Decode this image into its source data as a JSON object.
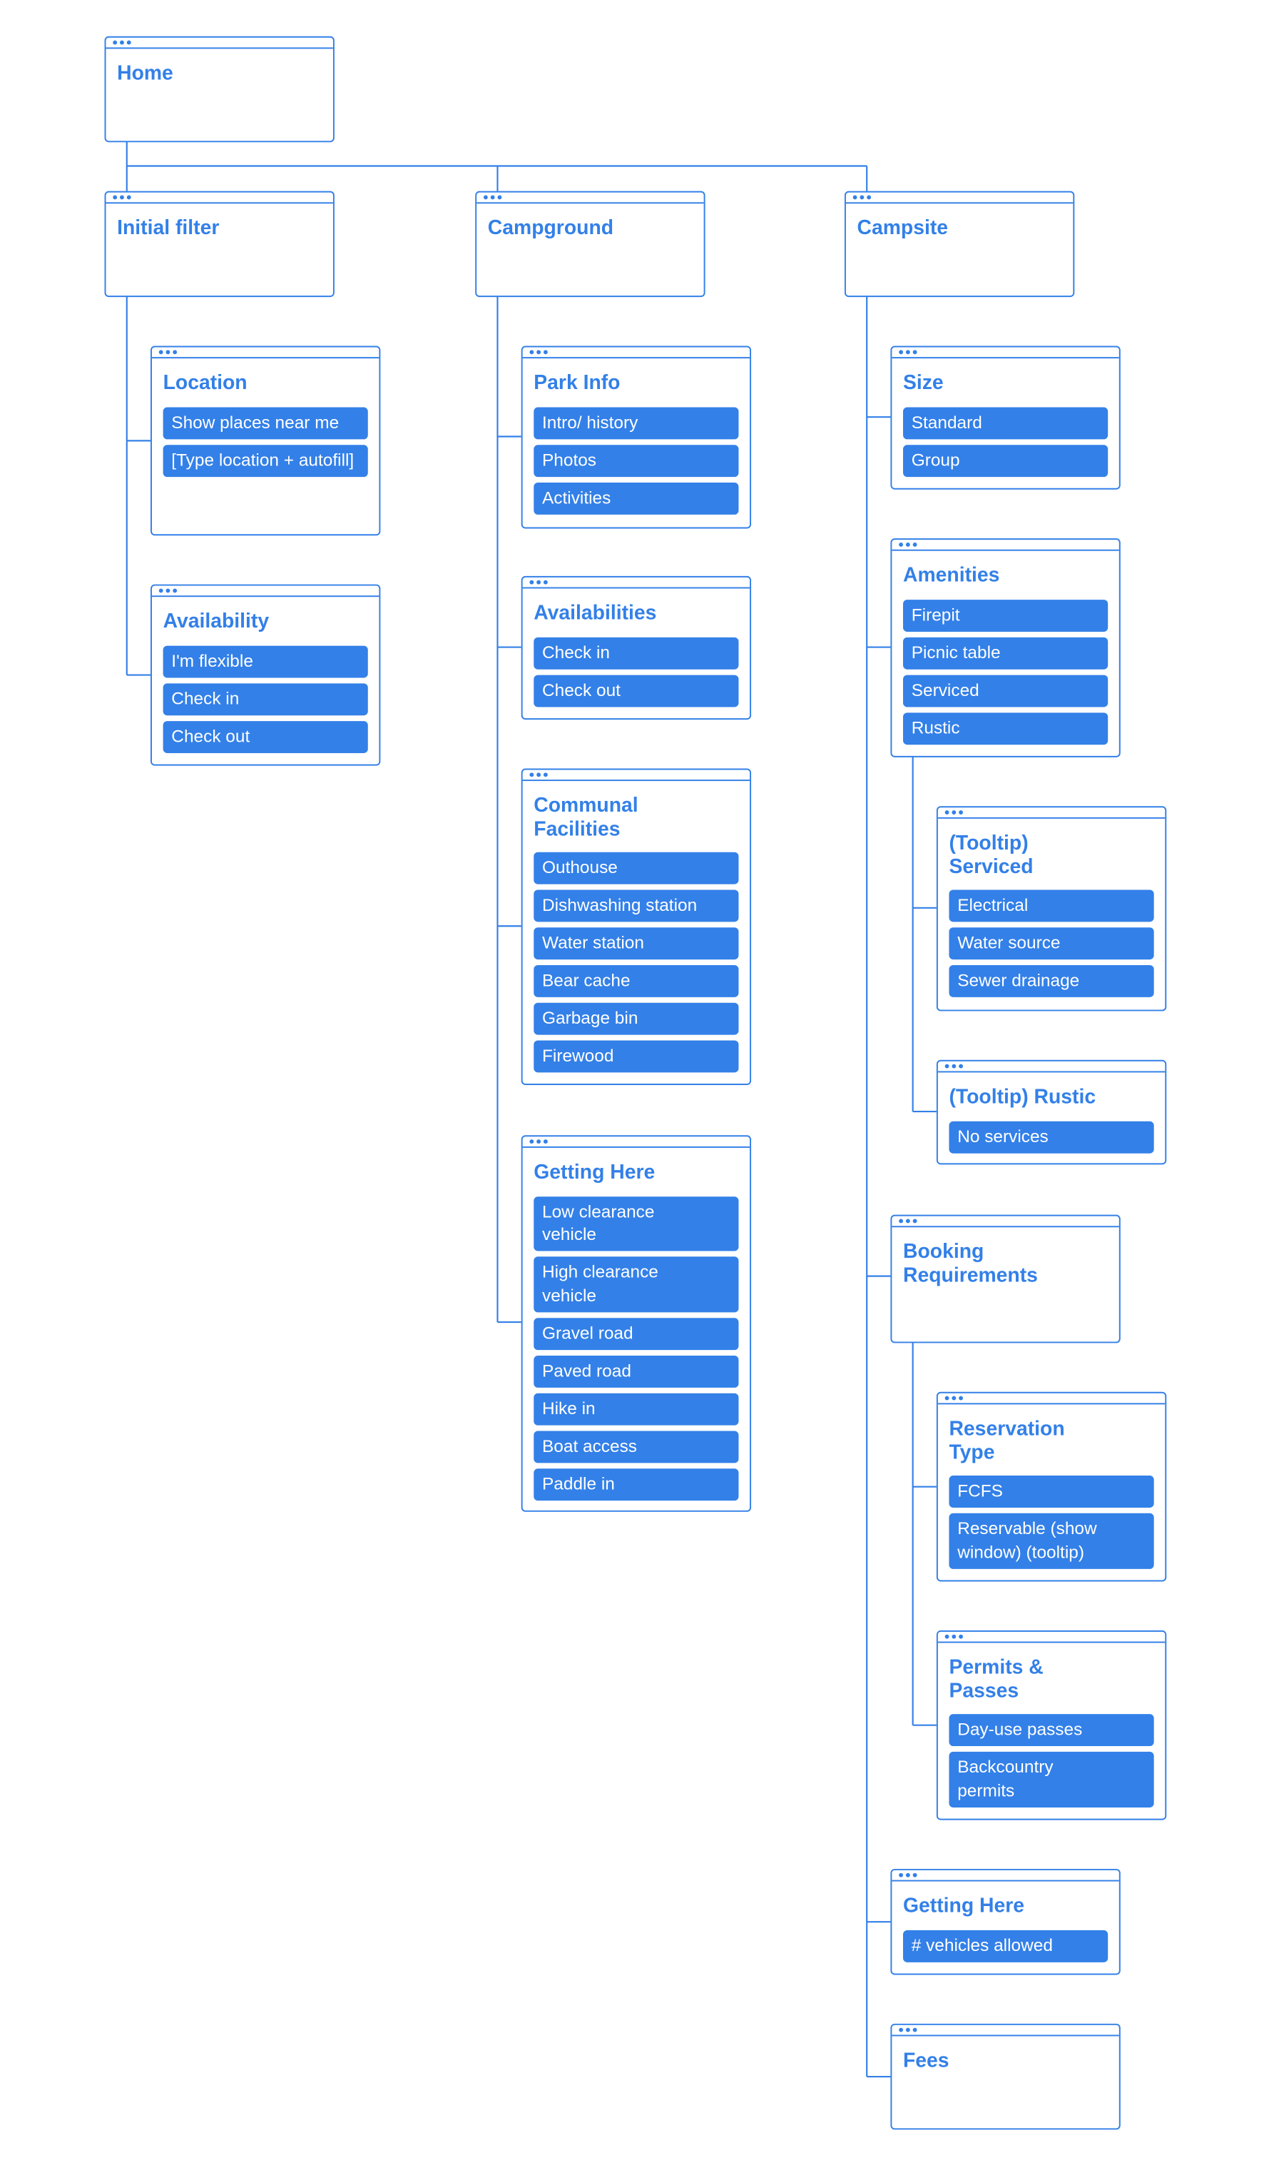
{
  "accent": "#3380e8",
  "home": {
    "title": "Home"
  },
  "initial_filter": {
    "title": "Initial filter",
    "location": {
      "title": "Location",
      "items": [
        "Show places near me",
        "[Type location + autofill]"
      ]
    },
    "availability": {
      "title": "Availability",
      "items": [
        "I'm flexible",
        "Check in",
        "Check out"
      ]
    }
  },
  "campground": {
    "title": "Campground",
    "park_info": {
      "title": "Park Info",
      "items": [
        "Intro/ history",
        "Photos",
        "Activities"
      ]
    },
    "availabilities": {
      "title": "Availabilities",
      "items": [
        "Check in",
        "Check out"
      ]
    },
    "communal": {
      "title": "Communal Facilities",
      "items": [
        "Outhouse",
        "Dishwashing station",
        "Water station",
        "Bear cache",
        "Garbage bin",
        "Firewood"
      ]
    },
    "getting_here": {
      "title": "Getting Here",
      "items": [
        "Low clearance vehicle",
        "High clearance vehicle",
        "Gravel road",
        "Paved road",
        "Hike in",
        "Boat access",
        "Paddle in"
      ]
    }
  },
  "campsite": {
    "title": "Campsite",
    "size": {
      "title": "Size",
      "items": [
        "Standard",
        "Group"
      ]
    },
    "amenities": {
      "title": "Amenities",
      "items": [
        "Firepit",
        "Picnic table",
        "Serviced",
        "Rustic"
      ]
    },
    "tooltip_serviced": {
      "title": "(Tooltip) Serviced",
      "items": [
        "Electrical",
        "Water source",
        "Sewer drainage"
      ]
    },
    "tooltip_rustic": {
      "title": "(Tooltip) Rustic",
      "items": [
        "No services"
      ]
    },
    "booking": {
      "title": "Booking Requirements"
    },
    "reservation_type": {
      "title": "Reservation Type",
      "items": [
        "FCFS",
        "Reservable (show window) (tooltip)"
      ]
    },
    "permits": {
      "title": "Permits & Passes",
      "items": [
        "Day-use passes",
        "Backcountry permits"
      ]
    },
    "getting_here": {
      "title": "Getting Here",
      "items": [
        "# vehicles allowed"
      ]
    },
    "fees": {
      "title": "Fees"
    }
  }
}
